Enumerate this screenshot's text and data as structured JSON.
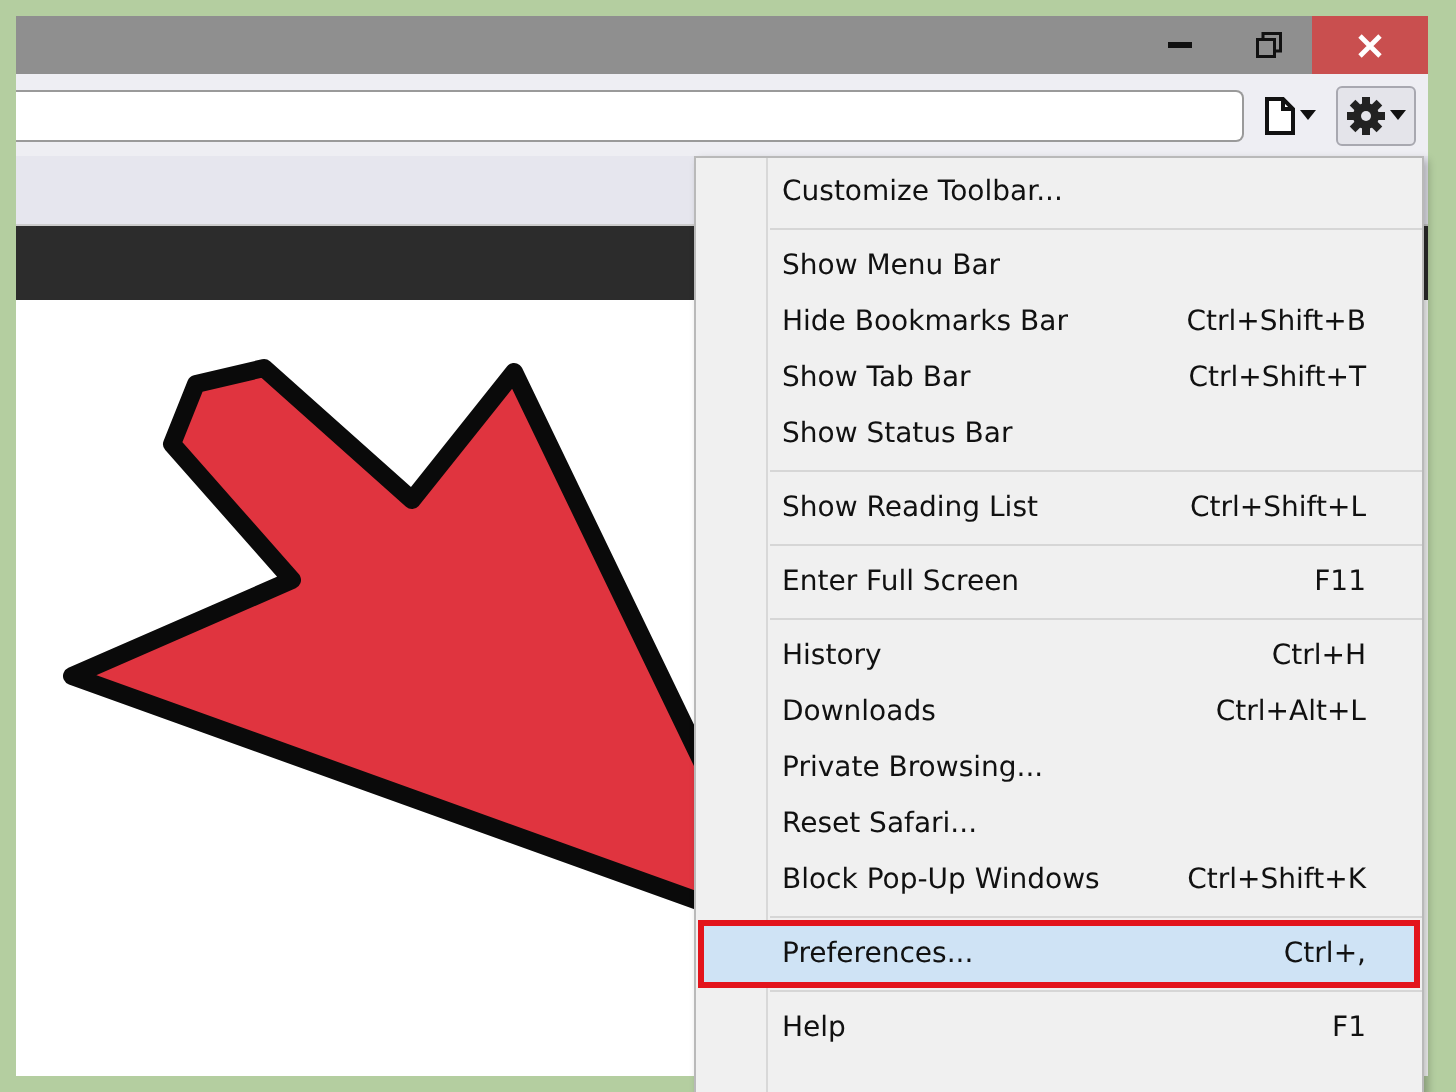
{
  "window": {
    "controls": [
      {
        "kind": "minimize"
      },
      {
        "kind": "maximize"
      },
      {
        "kind": "close"
      }
    ]
  },
  "menu": {
    "sections": [
      [
        {
          "label": "Customize Toolbar...",
          "selected": false
        }
      ],
      [
        {
          "label": "Show Menu Bar",
          "selected": false
        },
        {
          "label": "Hide Bookmarks Bar",
          "shortcut": "Ctrl+Shift+B",
          "selected": false
        },
        {
          "label": "Show Tab Bar",
          "shortcut": "Ctrl+Shift+T",
          "selected": false
        },
        {
          "label": "Show Status Bar",
          "selected": false
        }
      ],
      [
        {
          "label": "Show Reading List",
          "shortcut": "Ctrl+Shift+L",
          "selected": false
        }
      ],
      [
        {
          "label": "Enter Full Screen",
          "shortcut": "F11",
          "selected": false
        }
      ],
      [
        {
          "label": "History",
          "shortcut": "Ctrl+H",
          "selected": false
        },
        {
          "label": "Downloads",
          "shortcut": "Ctrl+Alt+L",
          "selected": false
        },
        {
          "label": "Private Browsing...",
          "selected": false
        },
        {
          "label": "Reset Safari...",
          "selected": false
        },
        {
          "label": "Block Pop-Up Windows",
          "shortcut": "Ctrl+Shift+K",
          "selected": false
        }
      ],
      [
        {
          "label": "Preferences...",
          "shortcut": "Ctrl+,",
          "selected": true
        }
      ],
      [
        {
          "label": "Help",
          "shortcut": "F1",
          "selected": false
        }
      ]
    ]
  }
}
